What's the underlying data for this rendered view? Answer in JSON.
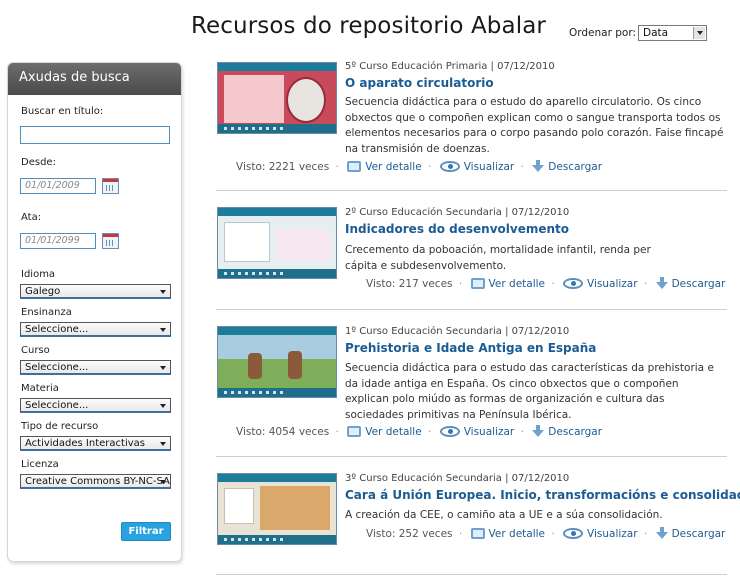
{
  "header": {
    "title": "Recursos do repositorio Abalar",
    "sort_label": "Ordenar por:",
    "sort_value": "Data"
  },
  "sidebar": {
    "title": "Axudas de busca",
    "search_label": "Buscar en título:",
    "search_value": "",
    "from_label": "Desde:",
    "from_value": "01/01/2009",
    "to_label": "Ata:",
    "to_value": "01/01/2099",
    "filters": [
      {
        "label": "Idioma",
        "value": "Galego"
      },
      {
        "label": "Ensinanza",
        "value": "Seleccione..."
      },
      {
        "label": "Curso",
        "value": "Seleccione..."
      },
      {
        "label": "Materia",
        "value": "Seleccione..."
      },
      {
        "label": "Tipo de recurso",
        "value": "Actividades Interactivas"
      },
      {
        "label": "Licenza",
        "value": "Creative Commons BY-NC-SA"
      }
    ],
    "filter_button": "Filtrar"
  },
  "actions": {
    "detail": "Ver detalle",
    "view": "Visualizar",
    "download": "Descargar"
  },
  "colors": {
    "accent": "#1c5c93",
    "button": "#29a3e0",
    "sidebar_header": "#555555"
  },
  "results": [
    {
      "meta": "5º Curso Educación Primaria | 07/12/2010",
      "title": "O aparato circulatorio",
      "desc": "Secuencia didáctica para o estudo do aparello circulatorio. Os cinco obxectos que o compoñen explican como o sangue transporta todos os elementos necesarios para o corpo pasando polo corazón. Faise fincapé na transmisión de doenzas.",
      "views": "Visto: 2221 veces"
    },
    {
      "meta": "2º Curso Educación Secundaria | 07/12/2010",
      "title": "Indicadores do desenvolvemento",
      "desc": "Crecemento da poboación, mortalidade infantil, renda per cápita e subdesenvolvemento.",
      "views": "Visto: 217 veces"
    },
    {
      "meta": "1º Curso Educación Secundaria | 07/12/2010",
      "title": "Prehistoria e Idade Antiga en España",
      "desc": "Secuencia didáctica para o estudo das características da prehistoria e da idade antiga en España. Os cinco obxectos que o compoñen explican polo miúdo as formas de organización e cultura das sociedades primitivas na Península Ibérica.",
      "views": "Visto: 4054 veces"
    },
    {
      "meta": "3º Curso Educación Secundaria | 07/12/2010",
      "title": "Cara á Unión Europea. Inicio, transformacións e consolidación.",
      "desc": "A creación da CEE, o camiño ata a UE e a súa consolidación.",
      "views": "Visto: 252 veces"
    }
  ]
}
